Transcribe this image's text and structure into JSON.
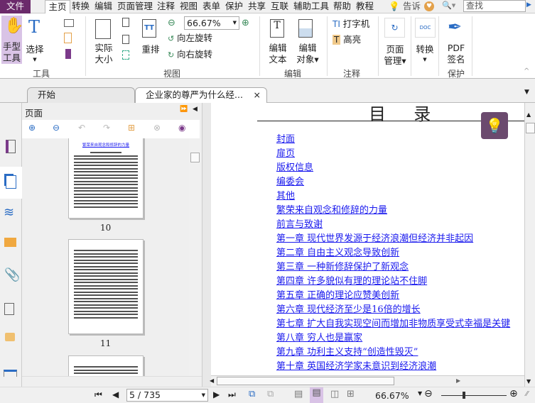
{
  "menu": {
    "file": "文件",
    "tabs": [
      "主页",
      "转换",
      "编辑",
      "页面管理",
      "注释",
      "视图",
      "表单",
      "保护",
      "共享",
      "互联",
      "辅助工具",
      "帮助",
      "教程"
    ],
    "tell_me": "告诉",
    "search_placeholder": "查找"
  },
  "ribbon": {
    "hand_tool": "手型\n工具",
    "hand_1": "手型",
    "hand_2": "工具",
    "select": "选择",
    "group_tools": "工具",
    "actual_size_1": "实际",
    "actual_size_2": "大小",
    "reflow": "重排",
    "zoom_value": "66.67%",
    "rotate_left": "向左旋转",
    "rotate_right": "向右旋转",
    "group_view": "视图",
    "edit_text_1": "编辑",
    "edit_text_2": "文本",
    "edit_object_1": "编辑",
    "edit_object_2": "对象",
    "group_edit": "编辑",
    "typewriter": "打字机",
    "highlight": "高亮",
    "group_comment": "注释",
    "page_manage_1": "页面",
    "page_manage_2": "管理",
    "convert": "转换",
    "pdf_sign_1": "PDF",
    "pdf_sign_2": "签名",
    "group_protect": "保护"
  },
  "doc_tabs": [
    {
      "label": "开始"
    },
    {
      "label": "企业家的尊严为什么经...",
      "close": "×"
    }
  ],
  "panel": {
    "title": "页面",
    "thumb_title": "繁荣来自观念和修辞的力量",
    "thumbnails": [
      {
        "page": "10"
      },
      {
        "page": "11"
      }
    ]
  },
  "document": {
    "heading": "目  录",
    "toc": [
      "封面",
      "扉页",
      "版权信息",
      "编委会",
      "其他",
      "繁荣来自观念和修辞的力量",
      "前言与致谢",
      "第一章  现代世界发源于经济浪潮但经济并非起因",
      "第二章  自由主义观念导致创新",
      "第三章  一种新修辞保护了新观念",
      "第四章  许多貌似有理的理论站不住脚",
      "第五章  正确的理论应赞美创新",
      "第六章  现代经济至少是16倍的增长",
      "第七章  扩大自我实现空间而增加非物质享受式幸福是关键",
      "第八章  穷人也是赢家",
      "第九章  功利主义支持“创造性毁灭”",
      "第十章  英国经济学家未意识到经济浪潮"
    ]
  },
  "status": {
    "page_input": "5 / 735",
    "zoom": "66.67%",
    "zoom_fraction": 0.35
  },
  "colors": {
    "accent": "#6b2a6b",
    "link": "#1a1aee",
    "active": "#d9c3e6"
  }
}
